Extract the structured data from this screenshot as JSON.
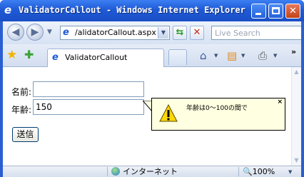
{
  "window": {
    "title": "ValidatorCallout - Windows Internet Explorer"
  },
  "navigation": {
    "address": "/alidatorCallout.aspx",
    "search_placeholder": "Live Search"
  },
  "tabs": [
    {
      "label": "ValidatorCallout",
      "active": true
    }
  ],
  "form": {
    "name_label": "名前:",
    "name_value": "",
    "age_label": "年齢:",
    "age_value": "150",
    "submit_label": "送信"
  },
  "callout": {
    "message": "年齢は0～100の間で",
    "close": "×"
  },
  "status_bar": {
    "zone": "インターネット",
    "zoom": "100%"
  },
  "colors": {
    "titlebar": "#1f5ad6",
    "callout_bg": "#ffffe1",
    "close_button": "#c24418"
  }
}
